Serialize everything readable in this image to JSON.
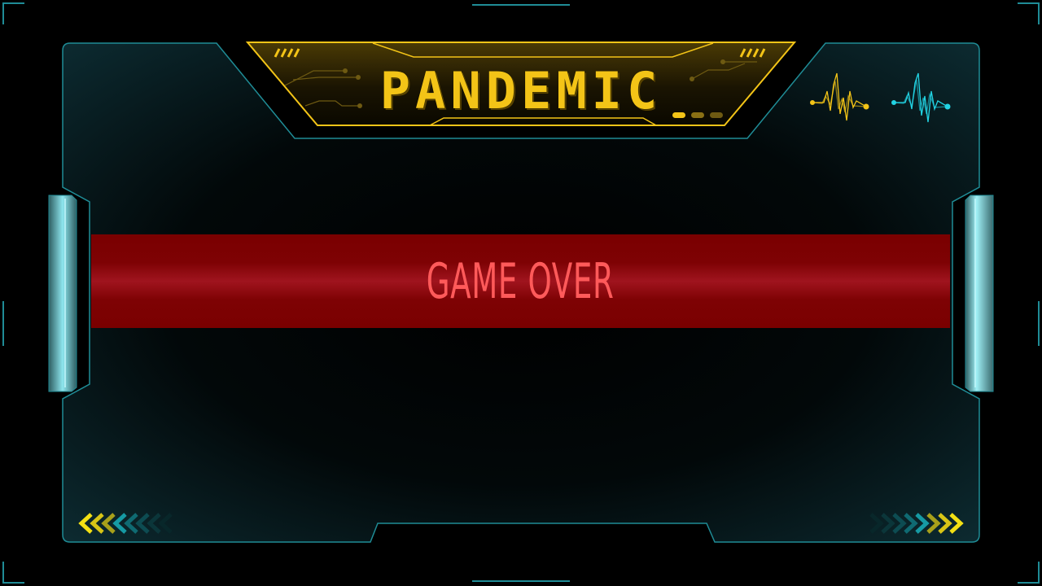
{
  "title": {
    "text": "PANDEMIC"
  },
  "banner": {
    "text": "GAME OVER"
  },
  "colors": {
    "frame_teal": "#1f8c96",
    "accent_yellow": "#f3c417",
    "banner_red": "#7e0204",
    "banner_text": "#ff5a5a",
    "heartbeat_cyan": "#22d4e4"
  },
  "icons": {
    "heartbeat_left": "heartbeat-yellow-icon",
    "heartbeat_right": "heartbeat-cyan-icon",
    "chevrons_left": "chevron-left-arrows-icon",
    "chevrons_right": "chevron-right-arrows-icon"
  }
}
